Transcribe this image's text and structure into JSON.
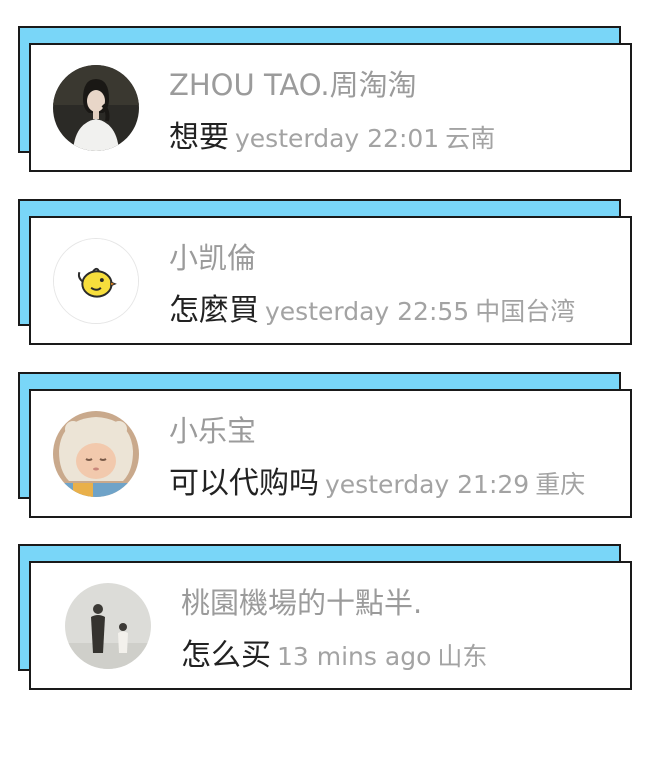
{
  "comments": [
    {
      "name": "ZHOU TAO.周淘淘",
      "message": "想要",
      "time": "yesterday 22:01",
      "location": "云南",
      "avatar_icon": "woman-portrait-avatar"
    },
    {
      "name": "小凯倫",
      "message": "怎麼買",
      "time": "yesterday 22:55",
      "location": "中国台湾",
      "avatar_icon": "yellow-chick-avatar"
    },
    {
      "name": "小乐宝",
      "message": "可以代购吗",
      "time": "yesterday 21:29",
      "location": "重庆",
      "avatar_icon": "baby-in-hat-avatar"
    },
    {
      "name": "桃園機場的十點半.",
      "message": "怎么买",
      "time": "13 mins ago",
      "location": "山东",
      "avatar_icon": "two-people-avatar"
    }
  ],
  "colors": {
    "accent_back": "#79d6f8",
    "border": "#1a1a1a",
    "name_text": "#9b9b9b",
    "meta_text": "#a3a3a3",
    "message_text": "#222222"
  }
}
